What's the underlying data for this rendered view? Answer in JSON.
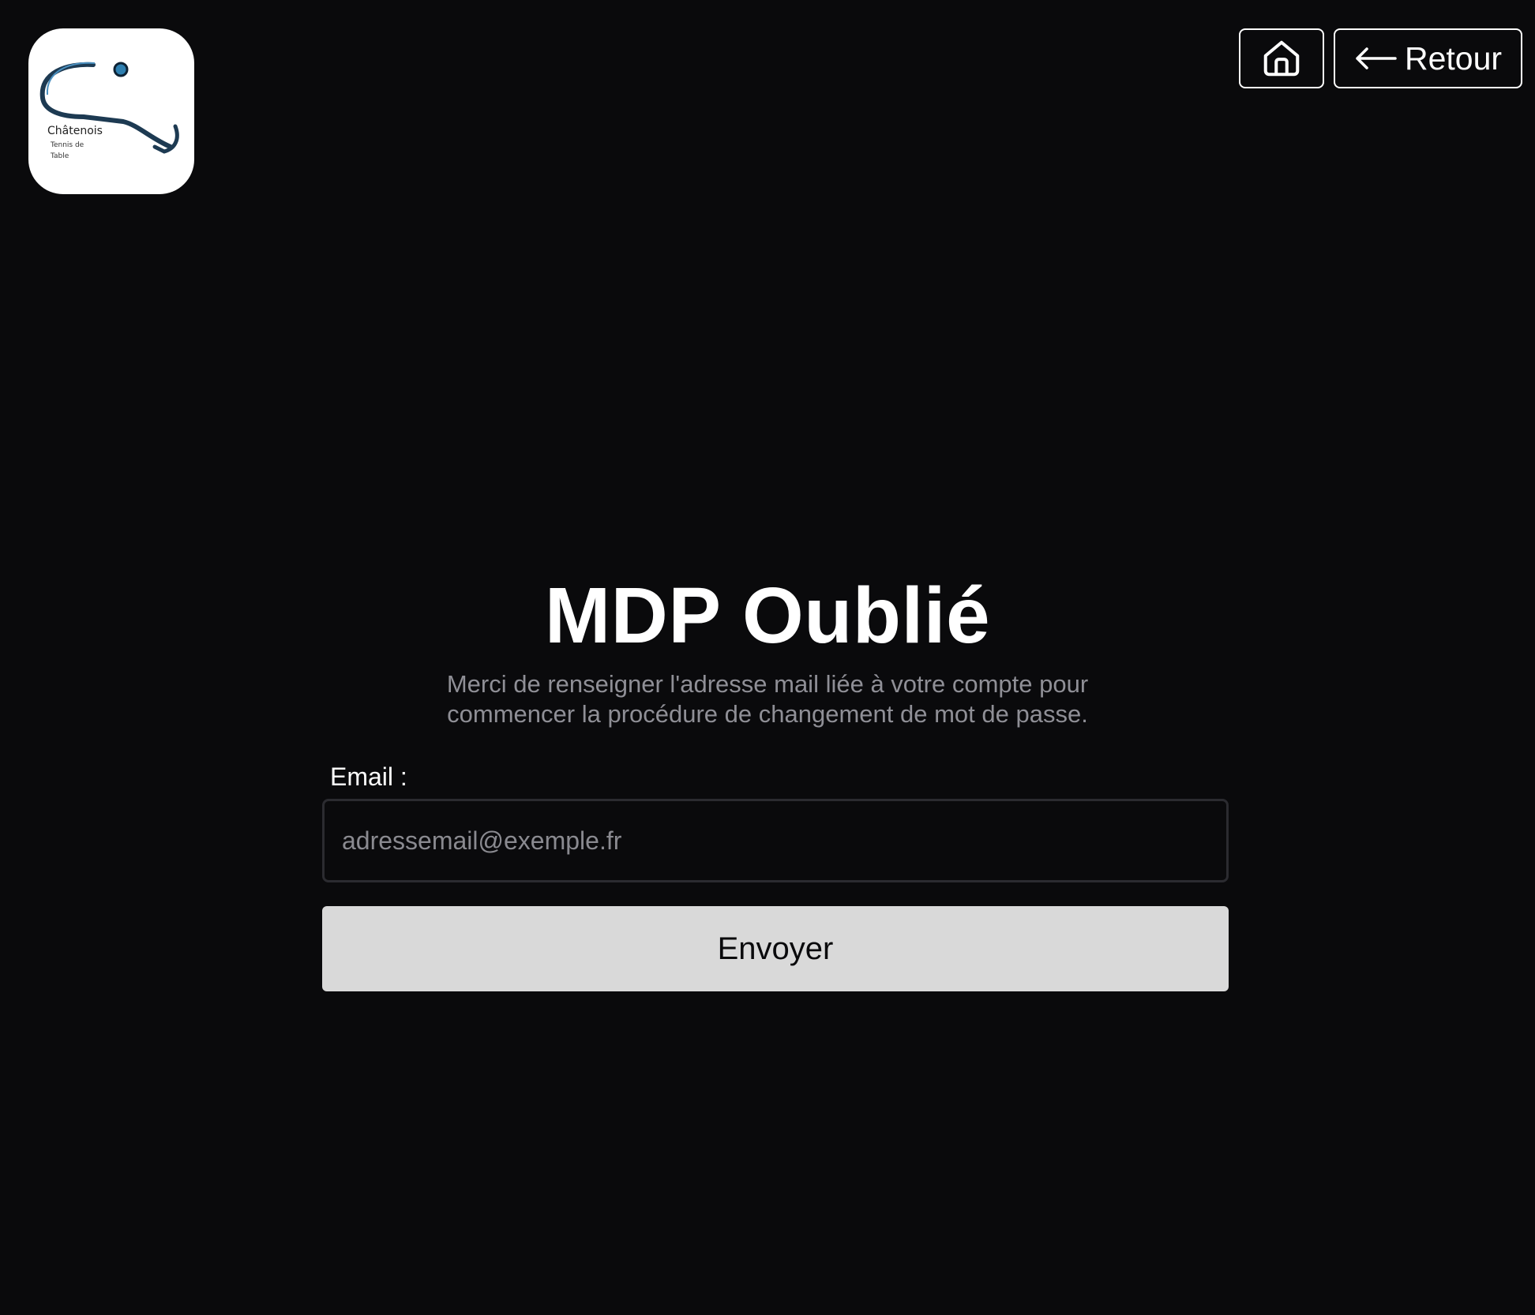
{
  "logo": {
    "name": "Châtenois",
    "line2": "Tennis de",
    "line3": "Table"
  },
  "nav": {
    "home_icon": "home-icon",
    "back_icon": "arrow-left-icon",
    "back_label": "Retour"
  },
  "main": {
    "title": "MDP Oublié",
    "subtitle_line1": "Merci de renseigner l'adresse mail liée à votre compte pour",
    "subtitle_line2": "commencer la procédure de changement de mot de passe."
  },
  "form": {
    "email_label": "Email :",
    "email_placeholder": "adressemail@exemple.fr",
    "email_value": "",
    "submit_label": "Envoyer"
  },
  "colors": {
    "background": "#0a0a0c",
    "text": "#ffffff",
    "muted_text": "#8f8f96",
    "button_bg": "#d9d9d9",
    "logo_accent": "#2e7fb0"
  }
}
